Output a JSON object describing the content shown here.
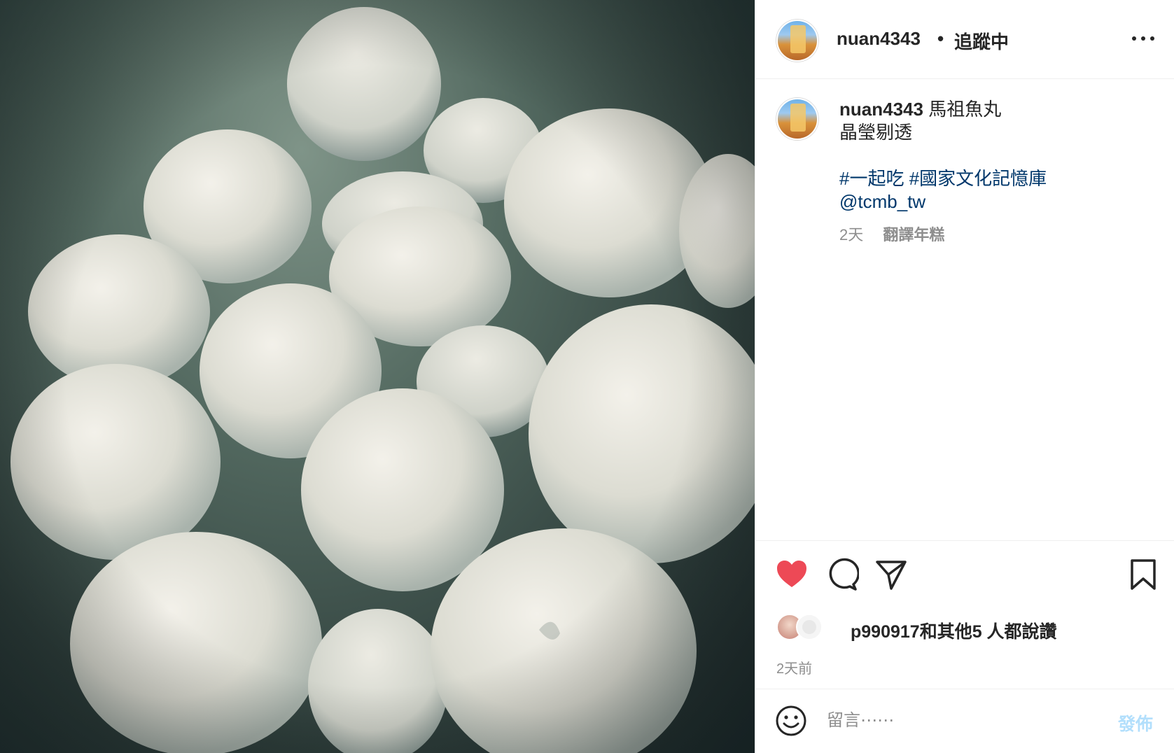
{
  "post": {
    "username": "nuan4343",
    "separator": "•",
    "follow_status": "追蹤中",
    "more_icon": "more-horizontal-icon"
  },
  "caption": {
    "username": "nuan4343",
    "line1": "馬祖魚丸",
    "line2": "晶瑩剔透",
    "hashtag1": "#一起吃",
    "hashtag2": "#國家文化記憶庫",
    "mention": "@tcmb_tw",
    "time": "2天",
    "translate": "翻譯年糕"
  },
  "actions": {
    "like_icon": "heart-filled-icon",
    "comment_icon": "comment-icon",
    "share_icon": "paper-plane-icon",
    "save_icon": "bookmark-icon",
    "like_color": "#ed4956"
  },
  "likes": {
    "user": "p990917",
    "rest": "和其他5 人都說讚"
  },
  "date": "2天前",
  "comment": {
    "emoji_icon": "smiley-icon",
    "placeholder": "留言⋯⋯",
    "post_label": "發佈"
  }
}
